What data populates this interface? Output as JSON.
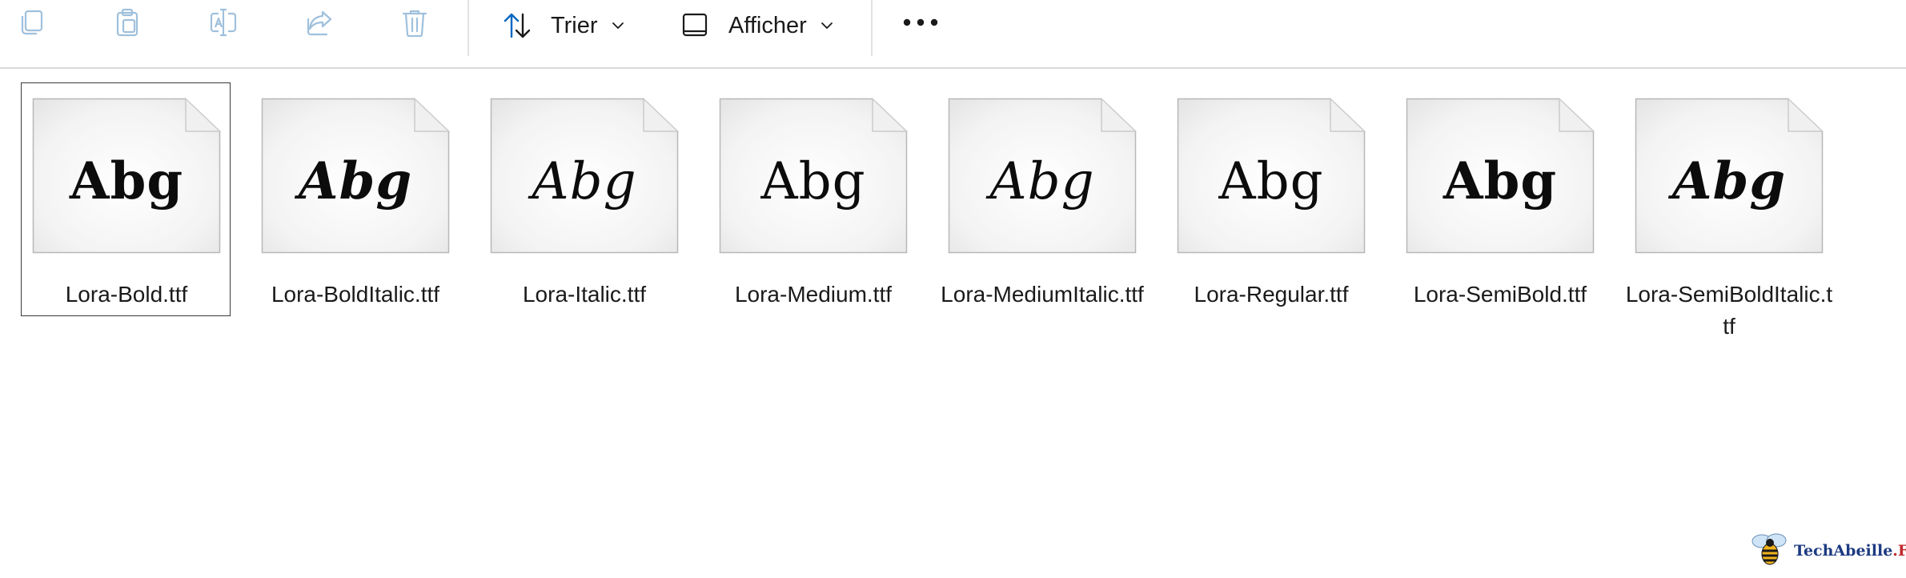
{
  "toolbar": {
    "copy_icon": "copy-icon",
    "paste_icon": "paste-icon",
    "rename_icon": "rename-icon",
    "share_icon": "share-icon",
    "delete_icon": "delete-icon",
    "sort_label": "Trier",
    "view_label": "Afficher",
    "more_icon": "more-icon",
    "icon_color_disabled": "#9fc0dc",
    "icon_color_active": "#0067c0"
  },
  "files": [
    {
      "name": "Lora-Bold.ttf",
      "preview": "Abg",
      "style": "bold",
      "selected": true
    },
    {
      "name": "Lora-BoldItalic.ttf",
      "preview": "Abg",
      "style": "bold-italic",
      "selected": false
    },
    {
      "name": "Lora-Italic.ttf",
      "preview": "Abg",
      "style": "italic",
      "selected": false
    },
    {
      "name": "Lora-Medium.ttf",
      "preview": "Abg",
      "style": "medium",
      "selected": false
    },
    {
      "name": "Lora-MediumItalic.ttf",
      "preview": "Abg",
      "style": "medium-italic",
      "selected": false
    },
    {
      "name": "Lora-Regular.ttf",
      "preview": "Abg",
      "style": "regular",
      "selected": false
    },
    {
      "name": "Lora-SemiBold.ttf",
      "preview": "Abg",
      "style": "semibold",
      "selected": false
    },
    {
      "name": "Lora-SemiBoldItalic.ttf",
      "preview": "Abg",
      "style": "semibold-italic",
      "selected": false
    }
  ],
  "watermark": {
    "text": "TechAbeille",
    "suffix": ".FR"
  }
}
